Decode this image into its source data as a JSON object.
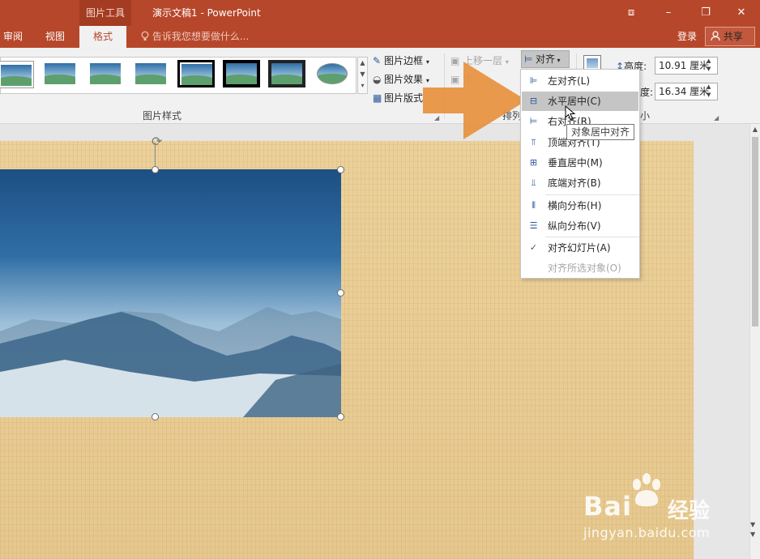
{
  "titlebar": {
    "context_tab": "图片工具",
    "doc_title": "演示文稿1 - PowerPoint",
    "restore_ribbon_icon": "⧈",
    "minimize_icon": "–",
    "maximize_icon": "❐",
    "close_icon": "✕"
  },
  "tabs": {
    "review": "审阅",
    "view": "视图",
    "format": "格式",
    "tell_me": "告诉我您想要做什么...",
    "sign_in": "登录",
    "share": "共享"
  },
  "ribbon": {
    "picture_styles_group": "图片样式",
    "border": "图片边框",
    "effects": "图片效果",
    "layout": "图片版式",
    "bring_forward": "上移一层",
    "send_backward": "下",
    "arrange_group": "排列",
    "align": "对齐",
    "height_label": "高度:",
    "height_value": "10.91 厘米",
    "width_label": "度:",
    "width_value": "16.34 厘米",
    "size_group": "小"
  },
  "align_menu": {
    "items": [
      {
        "label": "左对齐(L)",
        "icon": "align-left-icon"
      },
      {
        "label": "水平居中(C)",
        "icon": "align-center-icon"
      },
      {
        "label": "右对齐(R)",
        "icon": "align-right-icon"
      },
      {
        "label": "顶端对齐(T)",
        "icon": "align-top-icon"
      },
      {
        "label": "垂直居中(M)",
        "icon": "align-middle-icon"
      },
      {
        "label": "底端对齐(B)",
        "icon": "align-bottom-icon"
      },
      {
        "label": "横向分布(H)",
        "icon": "distribute-horizontal-icon"
      },
      {
        "label": "纵向分布(V)",
        "icon": "distribute-vertical-icon"
      },
      {
        "label": "对齐幻灯片(A)",
        "icon": "checkmark-icon"
      },
      {
        "label": "对齐所选对象(O)",
        "icon": ""
      }
    ],
    "tooltip": "对象居中对齐"
  },
  "watermark": {
    "brand": "Bai",
    "brand_suffix": "经验",
    "url": "jingyan.baidu.com"
  },
  "colors": {
    "accent": "#b7472a",
    "arrow": "#e8913e"
  }
}
